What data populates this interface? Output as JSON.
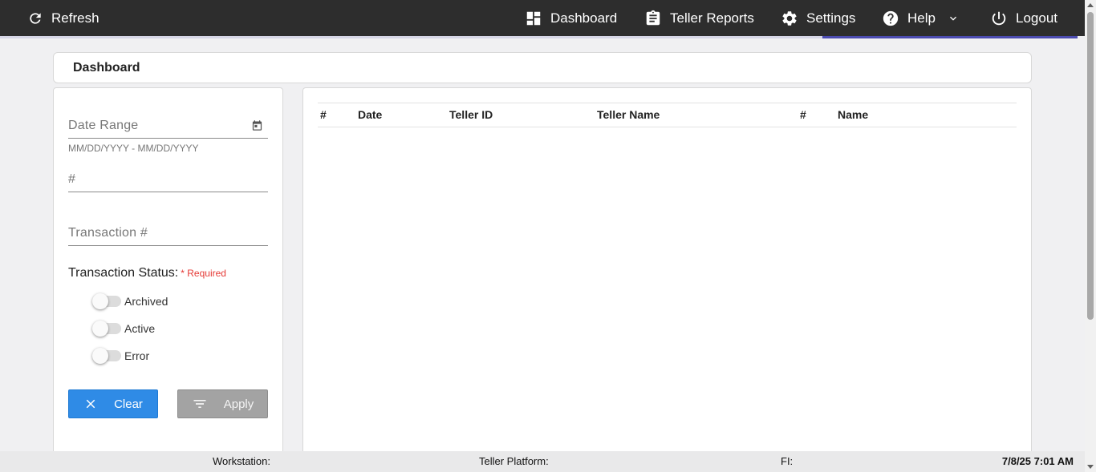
{
  "topbar": {
    "refresh": "Refresh",
    "dashboard": "Dashboard",
    "teller_reports": "Teller Reports",
    "settings": "Settings",
    "help": "Help",
    "logout": "Logout"
  },
  "breadcrumb": {
    "title": "Dashboard"
  },
  "filters": {
    "date_range_placeholder": "Date Range",
    "date_hint": "MM/DD/YYYY - MM/DD/YYYY",
    "number_placeholder": "#",
    "transaction_placeholder": "Transaction #",
    "status_label": "Transaction Status:",
    "required": "* Required",
    "toggles": [
      {
        "label": "Archived",
        "on": false
      },
      {
        "label": "Active",
        "on": false
      },
      {
        "label": "Error",
        "on": false
      }
    ],
    "clear_label": "Clear",
    "apply_label": "Apply"
  },
  "table": {
    "columns": [
      "#",
      "Date",
      "Teller ID",
      "Teller Name",
      "#",
      "Name"
    ],
    "rows": []
  },
  "footer": {
    "workstation": "Workstation:",
    "platform": "Teller Platform:",
    "fi": "FI:",
    "datetime": "7/8/25 7:01 AM"
  },
  "colors": {
    "topbar_bg": "#2d2d2d",
    "active_tab_indicator": "#4b4bb0",
    "clear_button": "#2f8be6",
    "apply_button": "#a3a3a3",
    "required_text": "#e53935"
  }
}
